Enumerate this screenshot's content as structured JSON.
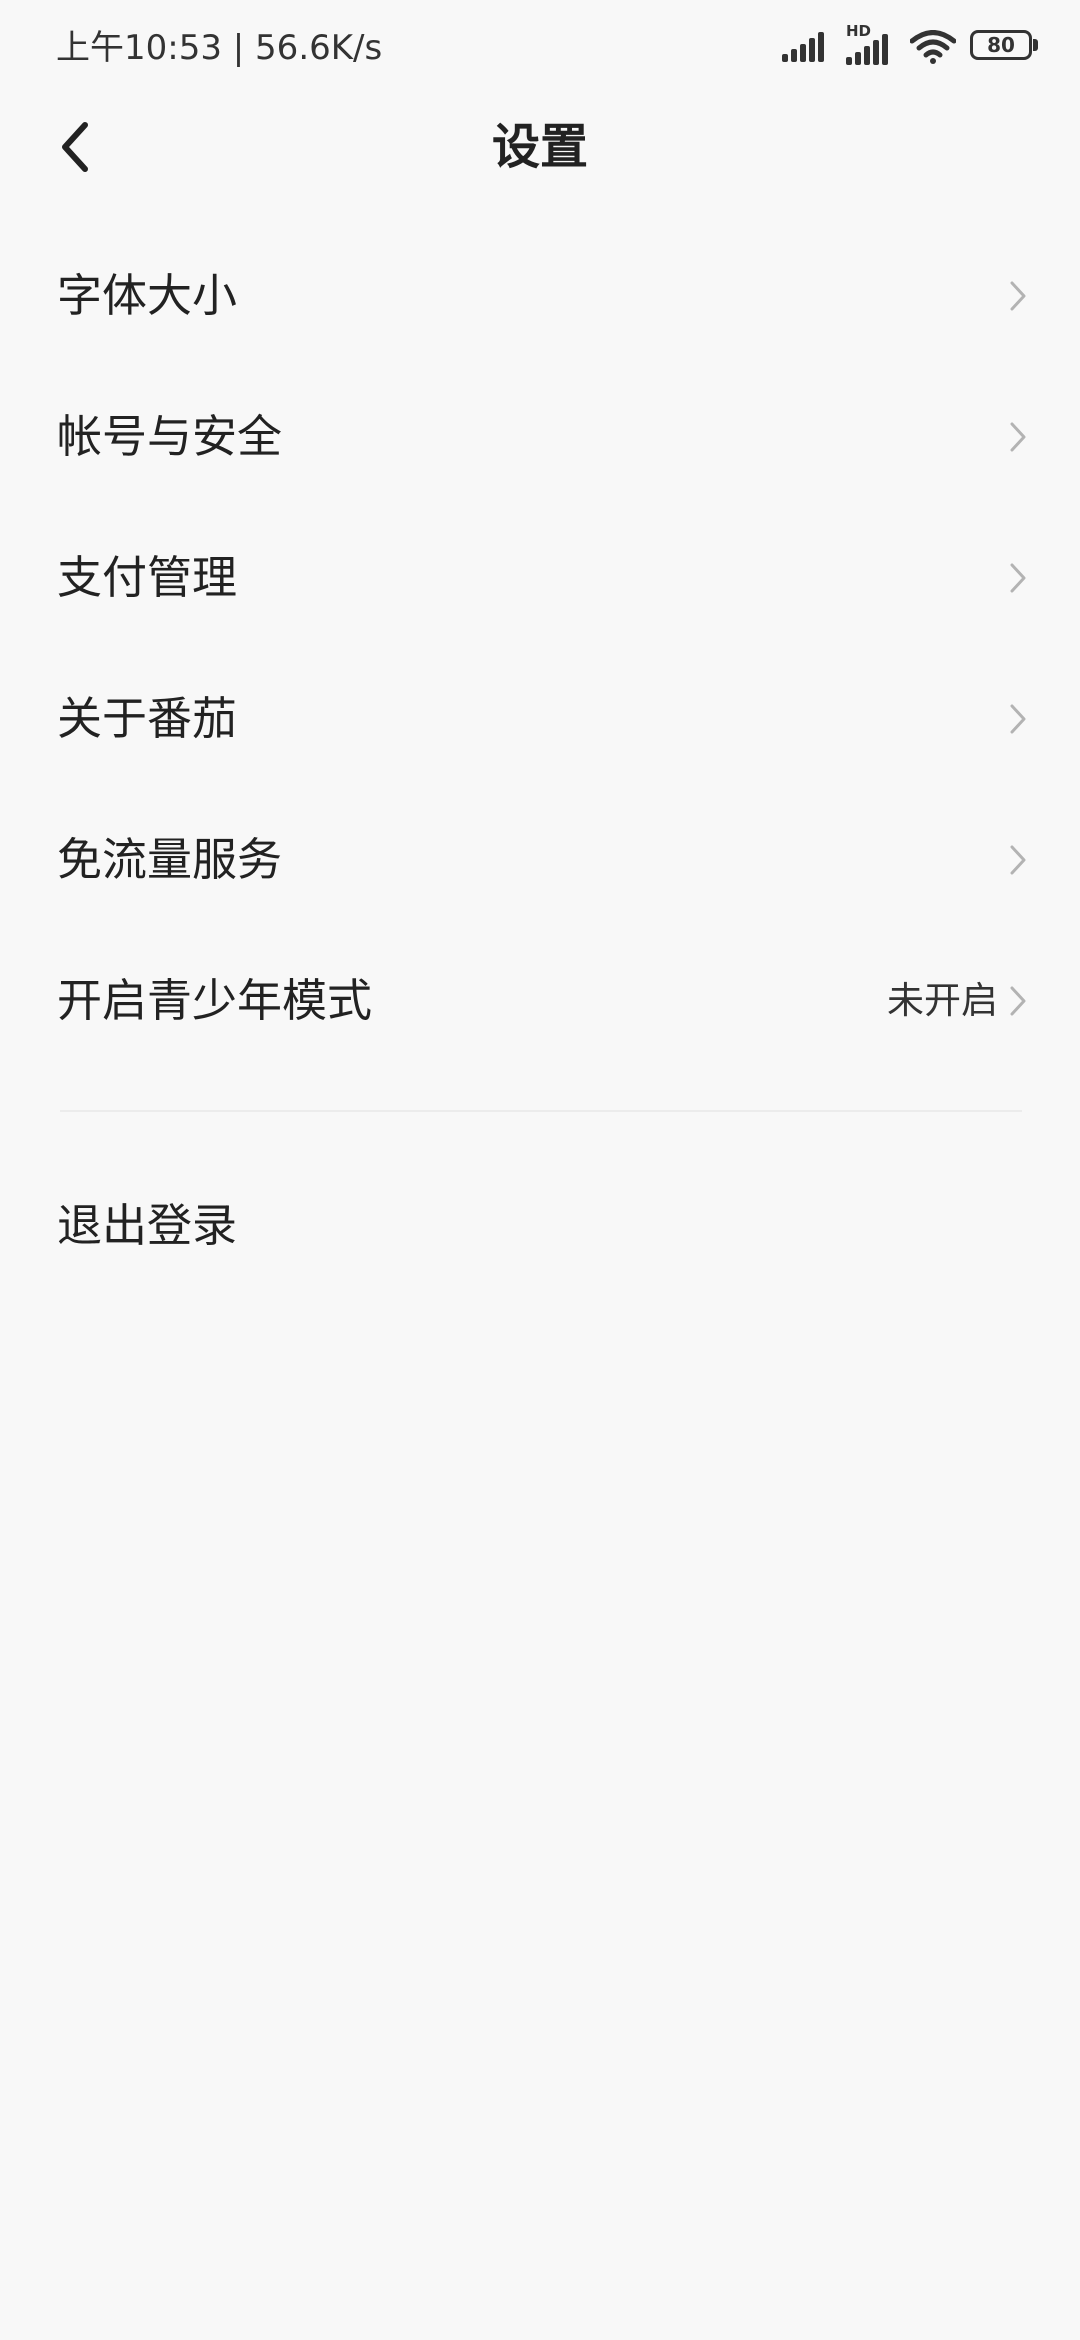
{
  "status_bar": {
    "time_speed": "上午10:53 | 56.6K/s",
    "network_badge": "HD",
    "battery_level": "80",
    "icons": [
      "signal-icon",
      "hd-signal-icon",
      "wifi-icon",
      "battery-icon"
    ]
  },
  "header": {
    "title": "设置",
    "back_icon": "chevron-left-icon"
  },
  "settings": [
    {
      "label": "字体大小",
      "value": ""
    },
    {
      "label": "帐号与安全",
      "value": ""
    },
    {
      "label": "支付管理",
      "value": ""
    },
    {
      "label": "关于番茄",
      "value": ""
    },
    {
      "label": "免流量服务",
      "value": ""
    },
    {
      "label": "开启青少年模式",
      "value": "未开启"
    }
  ],
  "logout": {
    "label": "退出登录"
  },
  "colors": {
    "background": "#f8f8f8",
    "text_primary": "#222222",
    "chevron": "#b3b3b3",
    "divider": "#ececec"
  }
}
